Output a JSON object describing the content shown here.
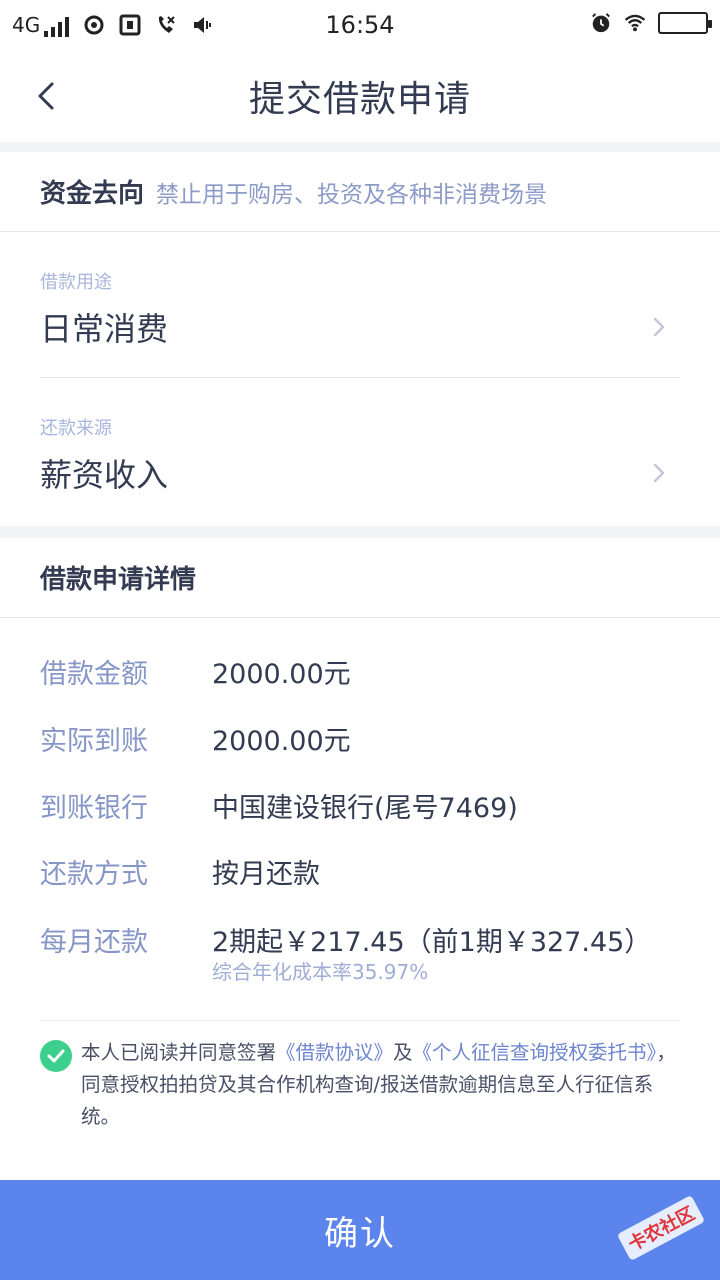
{
  "status_bar": {
    "network": "4G",
    "time": "16:54"
  },
  "nav": {
    "title": "提交借款申请"
  },
  "fund_direction": {
    "title": "资金去向",
    "note": "禁止用于购房、投资及各种非消费场景"
  },
  "purpose": {
    "label": "借款用途",
    "value": "日常消费"
  },
  "repay_source": {
    "label": "还款来源",
    "value": "薪资收入"
  },
  "details": {
    "title": "借款申请详情",
    "rows": [
      {
        "label": "借款金额",
        "value": "2000.00元"
      },
      {
        "label": "实际到账",
        "value": "2000.00元"
      },
      {
        "label": "到账银行",
        "value": "中国建设银行(尾号7469)"
      },
      {
        "label": "还款方式",
        "value": "按月还款"
      },
      {
        "label": "每月还款",
        "value": "2期起￥217.45（前1期￥327.45）",
        "sub": "综合年化成本率35.97%"
      }
    ]
  },
  "agreement": {
    "prefix": "本人已阅读并同意签署",
    "link1": "《借款协议》",
    "middle": "及",
    "link2": "《个人征信查询授权委托书》",
    "suffix": "，同意授权拍拍贷及其合作机构查询/报送借款逾期信息至人行征信系统。"
  },
  "confirm": {
    "label": "确认"
  },
  "watermark": {
    "text": "卡农社区"
  },
  "colors": {
    "primary": "#5b84ec",
    "check": "#3ccf8e",
    "label": "#8696c7",
    "link": "#6d85cf",
    "watermark": "#e0343a"
  }
}
